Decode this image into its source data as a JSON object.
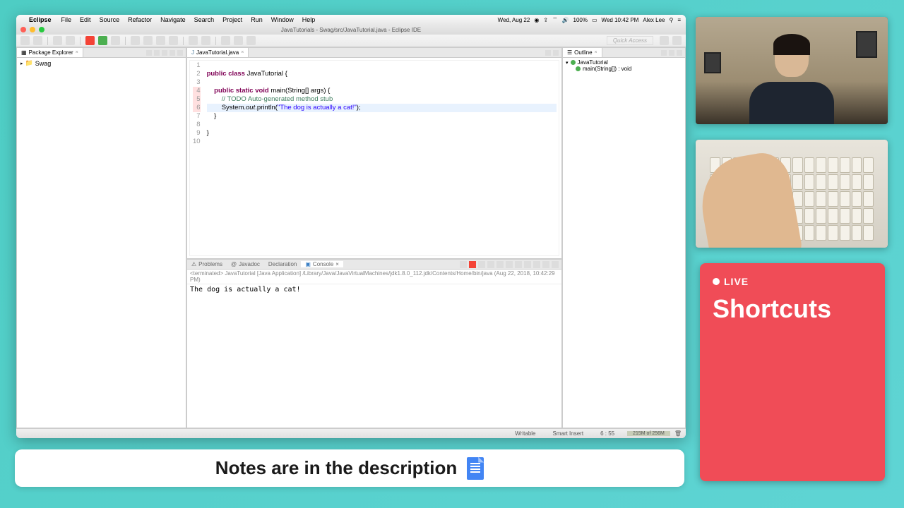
{
  "menubar": {
    "app": "Eclipse",
    "items": [
      "File",
      "Edit",
      "Source",
      "Refactor",
      "Navigate",
      "Search",
      "Project",
      "Run",
      "Window",
      "Help"
    ],
    "date": "Wed, Aug 22",
    "battery": "100%",
    "time": "Wed 10:42 PM",
    "user": "Alex Lee"
  },
  "titlebar": {
    "title": "JavaTutorials - Swag/src/JavaTutorial.java - Eclipse IDE"
  },
  "toolbar": {
    "quick_access": "Quick Access"
  },
  "explorer": {
    "tab": "Package Explorer",
    "items": [
      {
        "label": "Swag",
        "icon": "project"
      }
    ]
  },
  "editor": {
    "tab": "JavaTutorial.java",
    "lines": [
      {
        "n": 1,
        "raw": ""
      },
      {
        "n": 2,
        "raw": "<kw>public class</kw> JavaTutorial {"
      },
      {
        "n": 3,
        "raw": ""
      },
      {
        "n": 4,
        "raw": "    <kw>public static void</kw> main(String[] args) {",
        "marked": true
      },
      {
        "n": 5,
        "raw": "        <com>// TODO Auto-generated method stub</com>",
        "marked": true
      },
      {
        "n": 6,
        "raw": "        System.<ital>out</ital>.println(<str>\"The dog is actually a cat!\"</str>);",
        "hl": true,
        "marked": true
      },
      {
        "n": 7,
        "raw": "    }"
      },
      {
        "n": 8,
        "raw": ""
      },
      {
        "n": 9,
        "raw": "}"
      },
      {
        "n": 10,
        "raw": ""
      }
    ]
  },
  "outline": {
    "tab": "Outline",
    "items": [
      {
        "label": "JavaTutorial",
        "color": "green",
        "indent": 0
      },
      {
        "label": "main(String[]) : void",
        "color": "green",
        "indent": 1
      }
    ]
  },
  "console": {
    "tabs": [
      "Problems",
      "Javadoc",
      "Declaration",
      "Console"
    ],
    "active_tab": 3,
    "sub": "<terminated> JavaTutorial [Java Application] /Library/Java/JavaVirtualMachines/jdk1.8.0_112.jdk/Contents/Home/bin/java (Aug 22, 2018, 10:42:29 PM)",
    "output": "The dog is actually a cat!"
  },
  "status": {
    "writable": "Writable",
    "mode": "Smart Insert",
    "pos": "6 : 55",
    "mem": "215M of 256M"
  },
  "shortcuts": {
    "live": "LIVE",
    "title": "Shortcuts"
  },
  "notes": {
    "text": "Notes are in the description"
  }
}
